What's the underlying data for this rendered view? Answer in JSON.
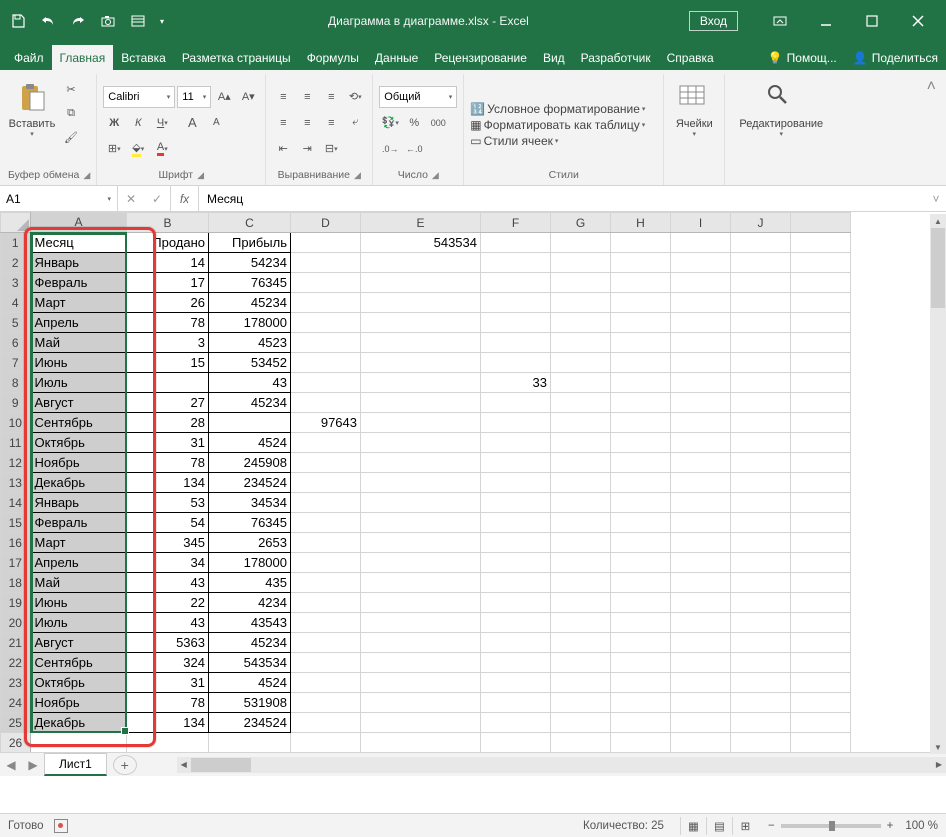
{
  "titlebar": {
    "title": "Диаграмма в диаграмме.xlsx - Excel",
    "login": "Вход"
  },
  "tabs": {
    "items": [
      "Файл",
      "Главная",
      "Вставка",
      "Разметка страницы",
      "Формулы",
      "Данные",
      "Рецензирование",
      "Вид",
      "Разработчик",
      "Справка"
    ],
    "active": 1,
    "help": "Помощ...",
    "share": "Поделиться"
  },
  "ribbon": {
    "clipboard": {
      "paste": "Вставить",
      "label": "Буфер обмена"
    },
    "font": {
      "name": "Calibri",
      "size": "11",
      "label": "Шрифт"
    },
    "align": {
      "label": "Выравнивание"
    },
    "number": {
      "format": "Общий",
      "label": "Число"
    },
    "styles": {
      "cond": "Условное форматирование ",
      "table": "Форматировать как таблицу ",
      "cell": "Стили ячеек ",
      "label": "Стили"
    },
    "cells": {
      "label": "Ячейки"
    },
    "editing": {
      "label": "Редактирование"
    }
  },
  "formulabar": {
    "namebox": "A1",
    "value": "Месяц"
  },
  "columns": [
    "A",
    "B",
    "C",
    "D",
    "E",
    "F",
    "G",
    "H",
    "I",
    "J"
  ],
  "col_widths": [
    "colA",
    "colB",
    "colC",
    "colD",
    "colE",
    "colF",
    "colG",
    "colH",
    "colI",
    "colJ"
  ],
  "headers": {
    "A": "Месяц",
    "B": "Продано",
    "C": "Прибыль",
    "E1": "543534"
  },
  "rows": [
    {
      "r": 1,
      "A": "Месяц",
      "B": "Продано",
      "C": "Прибыль",
      "E": "543534"
    },
    {
      "r": 2,
      "A": "Январь",
      "B": "14",
      "C": "54234"
    },
    {
      "r": 3,
      "A": "Февраль",
      "B": "17",
      "C": "76345"
    },
    {
      "r": 4,
      "A": "Март",
      "B": "26",
      "C": "45234"
    },
    {
      "r": 5,
      "A": "Апрель",
      "B": "78",
      "C": "178000"
    },
    {
      "r": 6,
      "A": "Май",
      "B": "3",
      "C": "4523"
    },
    {
      "r": 7,
      "A": "Июнь",
      "B": "15",
      "C": "53452"
    },
    {
      "r": 8,
      "A": "Июль",
      "B": "",
      "C": "43",
      "F": "33"
    },
    {
      "r": 9,
      "A": "Август",
      "B": "27",
      "C": "45234"
    },
    {
      "r": 10,
      "A": "Сентябрь",
      "B": "28",
      "C": "",
      "D": "97643"
    },
    {
      "r": 11,
      "A": "Октябрь",
      "B": "31",
      "C": "4524"
    },
    {
      "r": 12,
      "A": "Ноябрь",
      "B": "78",
      "C": "245908"
    },
    {
      "r": 13,
      "A": "Декабрь",
      "B": "134",
      "C": "234524"
    },
    {
      "r": 14,
      "A": "Январь",
      "B": "53",
      "C": "34534"
    },
    {
      "r": 15,
      "A": "Февраль",
      "B": "54",
      "C": "76345"
    },
    {
      "r": 16,
      "A": "Март",
      "B": "345",
      "C": "2653"
    },
    {
      "r": 17,
      "A": "Апрель",
      "B": "34",
      "C": "178000"
    },
    {
      "r": 18,
      "A": "Май",
      "B": "43",
      "C": "435"
    },
    {
      "r": 19,
      "A": "Июнь",
      "B": "22",
      "C": "4234"
    },
    {
      "r": 20,
      "A": "Июль",
      "B": "43",
      "C": "43543"
    },
    {
      "r": 21,
      "A": "Август",
      "B": "5363",
      "C": "45234"
    },
    {
      "r": 22,
      "A": "Сентябрь",
      "B": "324",
      "C": "543534"
    },
    {
      "r": 23,
      "A": "Октябрь",
      "B": "31",
      "C": "4524"
    },
    {
      "r": 24,
      "A": "Ноябрь",
      "B": "78",
      "C": "531908"
    },
    {
      "r": 25,
      "A": "Декабрь",
      "B": "134",
      "C": "234524"
    }
  ],
  "sheet": {
    "name": "Лист1"
  },
  "status": {
    "ready": "Готово",
    "count": "Количество: 25",
    "zoom": "100 %"
  }
}
